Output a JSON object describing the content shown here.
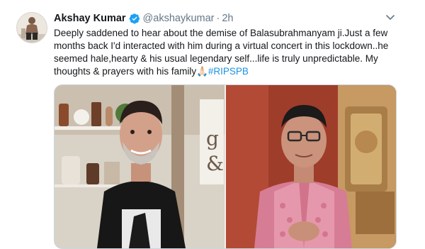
{
  "tweet": {
    "display_name": "Akshay Kumar",
    "handle": "@akshaykumar",
    "separator": "·",
    "time": "2h",
    "text_main": "Deeply saddened to hear about the demise of Balasubrahmanyam ji.Just a few months back I'd interacted with him during a virtual concert in this lockdown..he seemed hale,hearty & his usual legendary self...life is truly unpredictable. My thoughts & prayers with his family",
    "emoji": "🙏🏻",
    "hashtag": "#RIPSPB"
  },
  "icons": {
    "verified": "verified-badge-icon",
    "caret": "chevron-down-icon"
  },
  "colors": {
    "link": "#1b95e0",
    "secondary_text": "#657786",
    "verified": "#1da1f2",
    "border": "#ccd6dd"
  }
}
